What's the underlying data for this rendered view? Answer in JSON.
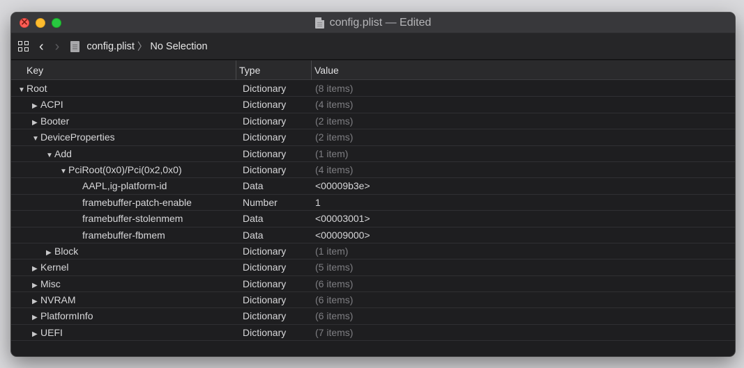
{
  "window": {
    "title": "config.plist — Edited"
  },
  "toolbar": {
    "back_glyph": "‹",
    "forward_glyph": "›",
    "breadcrumb_file": "config.plist",
    "breadcrumb_sep": "〉",
    "breadcrumb_selection": "No Selection"
  },
  "columns": {
    "key": "Key",
    "type": "Type",
    "value": "Value"
  },
  "rows": [
    {
      "key": "Root",
      "type": "Dictionary",
      "value": "(8 items)",
      "depth": 0,
      "expander": "open",
      "muted": true
    },
    {
      "key": "ACPI",
      "type": "Dictionary",
      "value": "(4 items)",
      "depth": 1,
      "expander": "closed",
      "muted": true
    },
    {
      "key": "Booter",
      "type": "Dictionary",
      "value": "(2 items)",
      "depth": 1,
      "expander": "closed",
      "muted": true
    },
    {
      "key": "DeviceProperties",
      "type": "Dictionary",
      "value": "(2 items)",
      "depth": 1,
      "expander": "open",
      "muted": true
    },
    {
      "key": "Add",
      "type": "Dictionary",
      "value": "(1 item)",
      "depth": 2,
      "expander": "open",
      "muted": true
    },
    {
      "key": "PciRoot(0x0)/Pci(0x2,0x0)",
      "type": "Dictionary",
      "value": "(4 items)",
      "depth": 3,
      "expander": "open",
      "muted": true
    },
    {
      "key": "AAPL,ig-platform-id",
      "type": "Data",
      "value": "<00009b3e>",
      "depth": 4,
      "expander": "none",
      "muted": false
    },
    {
      "key": "framebuffer-patch-enable",
      "type": "Number",
      "value": "1",
      "depth": 4,
      "expander": "none",
      "muted": false
    },
    {
      "key": "framebuffer-stolenmem",
      "type": "Data",
      "value": "<00003001>",
      "depth": 4,
      "expander": "none",
      "muted": false
    },
    {
      "key": "framebuffer-fbmem",
      "type": "Data",
      "value": "<00009000>",
      "depth": 4,
      "expander": "none",
      "muted": false
    },
    {
      "key": "Block",
      "type": "Dictionary",
      "value": "(1 item)",
      "depth": 2,
      "expander": "closed",
      "muted": true
    },
    {
      "key": "Kernel",
      "type": "Dictionary",
      "value": "(5 items)",
      "depth": 1,
      "expander": "closed",
      "muted": true
    },
    {
      "key": "Misc",
      "type": "Dictionary",
      "value": "(6 items)",
      "depth": 1,
      "expander": "closed",
      "muted": true
    },
    {
      "key": "NVRAM",
      "type": "Dictionary",
      "value": "(6 items)",
      "depth": 1,
      "expander": "closed",
      "muted": true
    },
    {
      "key": "PlatformInfo",
      "type": "Dictionary",
      "value": "(6 items)",
      "depth": 1,
      "expander": "closed",
      "muted": true
    },
    {
      "key": "UEFI",
      "type": "Dictionary",
      "value": "(7 items)",
      "depth": 1,
      "expander": "closed",
      "muted": true
    }
  ],
  "colors": {
    "window_bg": "#1e1e20",
    "close": "#fe5f57",
    "minimize": "#febc2e",
    "maximize": "#28c840",
    "muted_value": "#7e7e82"
  }
}
